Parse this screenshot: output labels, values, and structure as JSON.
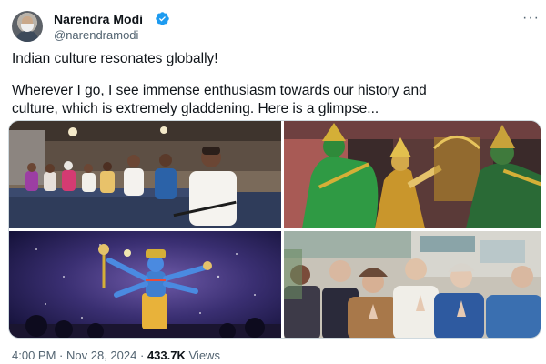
{
  "author": {
    "name": "Narendra Modi",
    "handle": "@narendramodi",
    "verified_icon": "verified-badge-icon",
    "verified_color": "#1d9bf0"
  },
  "more_icon": "more-horizontal-icon",
  "post": {
    "line1": "Indian culture resonates globally!",
    "line2a": "Wherever I go, I see immense enthusiasm towards our history and",
    "line2b": "culture, which is extremely gladdening. Here is a glimpse..."
  },
  "media": [
    {
      "name": "seated-audience-photo"
    },
    {
      "name": "costumed-dancers-photo"
    },
    {
      "name": "vishnu-performance-photo"
    },
    {
      "name": "praying-crowd-photo"
    }
  ],
  "meta": {
    "time": "4:00 PM",
    "separator": "·",
    "date": "Nov 28, 2024",
    "views_count": "433.7K",
    "views_label": "Views"
  }
}
